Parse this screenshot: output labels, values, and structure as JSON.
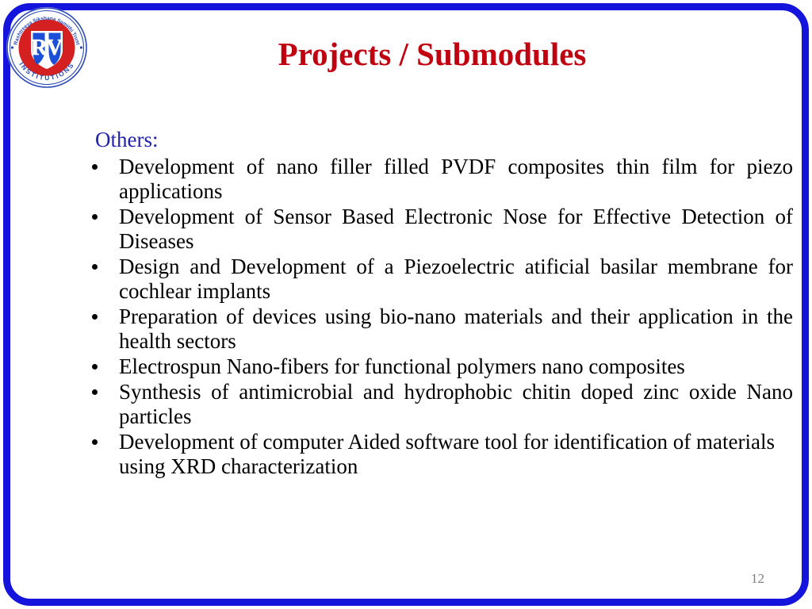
{
  "slide": {
    "title": "Projects / Submodules",
    "page_number": "12",
    "title_color": "#c00011",
    "border_color": "#1414dc",
    "heading_color": "#2222aa",
    "body_color": "#000000",
    "page_number_color": "#808080",
    "background_color": "#ffffff"
  },
  "logo": {
    "name": "rv-institutions-logo",
    "arc_top_text": "Rashtreeya Sikshana Samithi Trust",
    "arc_bottom_text": "INSTITUTIONS",
    "monogram": "RV",
    "ring_color": "#d42020",
    "shield_blue": "#1b4fd8",
    "shield_white": "#ffffff"
  },
  "content": {
    "heading": "Others:",
    "bullets": [
      "Development of nano  filler filled PVDF composites thin film for piezo applications",
      "Development of Sensor Based Electronic Nose for Effective Detection of Diseases",
      "Design and Development of a Piezoelectric atificial basilar membrane for cochlear implants",
      "Preparation of devices using bio-nano materials and their application in the health sectors",
      "Electrospun Nano-fibers for functional polymers nano composites",
      "Synthesis of antimicrobial and hydrophobic chitin doped zinc oxide Nano particles",
      "Development of computer Aided software tool for identification of materials using XRD characterization"
    ]
  }
}
